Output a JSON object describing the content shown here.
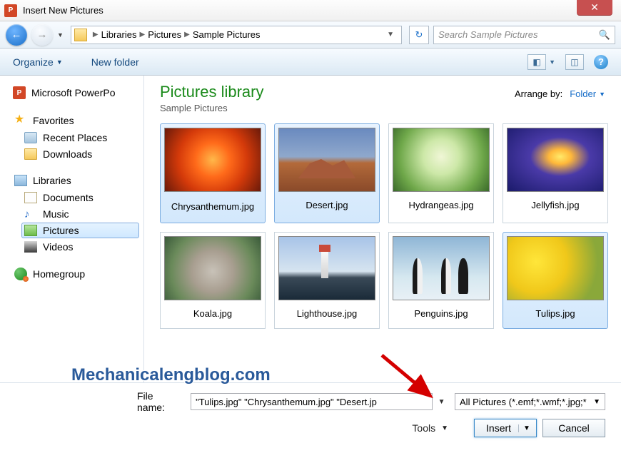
{
  "title": "Insert New Pictures",
  "breadcrumb": {
    "root": "Libraries",
    "mid": "Pictures",
    "leaf": "Sample Pictures"
  },
  "search_placeholder": "Search Sample Pictures",
  "toolbar": {
    "organize": "Organize",
    "newfolder": "New folder"
  },
  "sidebar": {
    "app": "Microsoft PowerPo",
    "fav": "Favorites",
    "fav_items": {
      "recent": "Recent Places",
      "downloads": "Downloads"
    },
    "lib": "Libraries",
    "lib_items": {
      "documents": "Documents",
      "music": "Music",
      "pictures": "Pictures",
      "videos": "Videos"
    },
    "homegroup": "Homegroup"
  },
  "library": {
    "title": "Pictures library",
    "sub": "Sample Pictures",
    "arrange_label": "Arrange by:",
    "arrange_value": "Folder"
  },
  "thumbs": [
    {
      "label": "Chrysanthemum.jpg",
      "selected": true,
      "img": "img-chrys"
    },
    {
      "label": "Desert.jpg",
      "selected": true,
      "img": "img-desert"
    },
    {
      "label": "Hydrangeas.jpg",
      "selected": false,
      "img": "img-hydra"
    },
    {
      "label": "Jellyfish.jpg",
      "selected": false,
      "img": "img-jelly"
    },
    {
      "label": "Koala.jpg",
      "selected": false,
      "img": "img-koala"
    },
    {
      "label": "Lighthouse.jpg",
      "selected": false,
      "img": "img-light"
    },
    {
      "label": "Penguins.jpg",
      "selected": false,
      "img": "img-peng"
    },
    {
      "label": "Tulips.jpg",
      "selected": true,
      "img": "img-tulips"
    }
  ],
  "footer": {
    "fname_label": "File name:",
    "fname_value": "\"Tulips.jpg\" \"Chrysanthemum.jpg\" \"Desert.jp",
    "filter": "All Pictures (*.emf;*.wmf;*.jpg;*",
    "tools": "Tools",
    "insert": "Insert",
    "cancel": "Cancel"
  },
  "watermark": "Mechanicalengblog.com"
}
